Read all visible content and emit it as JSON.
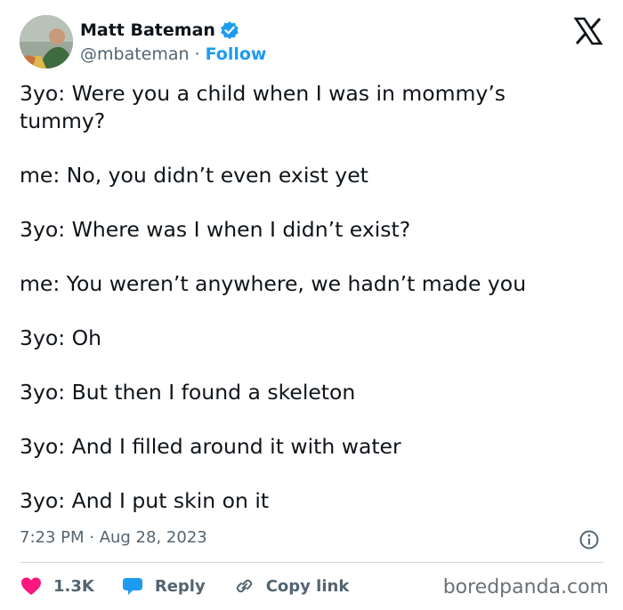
{
  "header": {
    "display_name": "Matt Bateman",
    "handle": "@mbateman",
    "separator": "·",
    "follow_label": "Follow"
  },
  "tweet": {
    "lines": [
      "3yo: Were you a child when I was in mommy’s tummy?",
      "me: No, you didn’t even exist yet",
      "3yo: Where was I when I didn’t exist?",
      "me: You weren’t anywhere, we hadn’t made you",
      "3yo: Oh",
      "3yo: But then I found a skeleton",
      "3yo: And I filled around it with water",
      "3yo: And I put skin on it"
    ],
    "timestamp": "7:23 PM · Aug 28, 2023"
  },
  "actions": {
    "like_count": "1.3K",
    "reply_label": "Reply",
    "copy_link_label": "Copy link"
  },
  "watermark": "boredpanda.com",
  "colors": {
    "text": "#0f1419",
    "secondary": "#536471",
    "accent_blue": "#1d9bf0",
    "like_pink": "#f91880",
    "divider": "#cfd9de"
  },
  "icons": {
    "verified": "verified-badge-icon",
    "platform": "x-logo-icon",
    "info": "info-icon",
    "like": "heart-icon",
    "reply": "speech-bubble-icon",
    "copy": "link-icon"
  }
}
